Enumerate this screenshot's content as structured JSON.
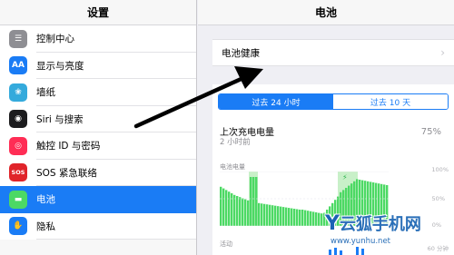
{
  "sidebar": {
    "title": "设置",
    "items": [
      {
        "label": "控制中心",
        "icon": "control-center-icon",
        "color": "#8e8e93",
        "glyph": "☰"
      },
      {
        "label": "显示与亮度",
        "icon": "display-brightness-icon",
        "color": "#1a7cf5",
        "glyph": "AA"
      },
      {
        "label": "墙纸",
        "icon": "wallpaper-icon",
        "color": "#34aadc",
        "glyph": "❀"
      },
      {
        "label": "Siri 与搜索",
        "icon": "siri-icon",
        "color": "#1c1c1e",
        "glyph": "◉"
      },
      {
        "label": "触控 ID 与密码",
        "icon": "touch-id-icon",
        "color": "#ff2d55",
        "glyph": "◎"
      },
      {
        "label": "SOS 紧急联络",
        "icon": "sos-icon",
        "color": "#e0242a",
        "glyph": "SOS"
      },
      {
        "label": "电池",
        "icon": "battery-icon",
        "color": "#4cd964",
        "glyph": "▬",
        "active": true
      },
      {
        "label": "隐私",
        "icon": "privacy-hand-icon",
        "color": "#1a7cf5",
        "glyph": "✋"
      }
    ]
  },
  "detail": {
    "title": "电池",
    "health_label": "电池健康",
    "segments": [
      "过去 24 小时",
      "过去 10 天"
    ],
    "selected_segment": 0,
    "last_charge_label": "上次充电电量",
    "last_charge_time": "2 小时前",
    "last_charge_percent": "75%",
    "chart_title": "电池电量",
    "chart_ticks": [
      "100%",
      "50%",
      "0%"
    ],
    "activity_label": "活动",
    "activity_tick": "60 分钟"
  },
  "watermark": {
    "brand_y": "Y",
    "brand": "云狐手机网",
    "url": "www.yunhu.net"
  },
  "colors": {
    "accent": "#1a7cf5",
    "battery_green": "#4cd964",
    "charging_band": "#c8f0c8"
  }
}
